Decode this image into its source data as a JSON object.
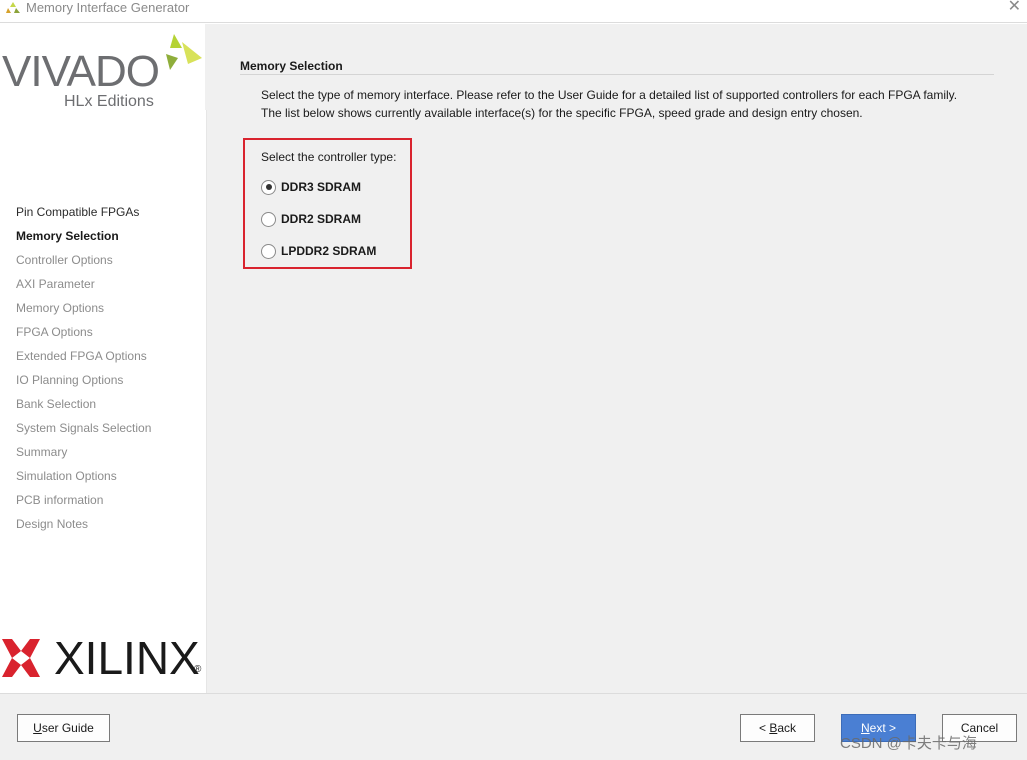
{
  "window": {
    "title": "Memory Interface Generator",
    "close_glyph": "✕"
  },
  "branding": {
    "vivado_word": "VIVADO",
    "hlx_word": "HLx Editions",
    "xilinx_word": "XILINX",
    "xilinx_reg": "®"
  },
  "sidebar": {
    "items": [
      {
        "label": "Pin Compatible FPGAs",
        "state": "done"
      },
      {
        "label": "Memory Selection",
        "state": "active"
      },
      {
        "label": "Controller Options",
        "state": "pending"
      },
      {
        "label": "AXI Parameter",
        "state": "pending"
      },
      {
        "label": "Memory Options",
        "state": "pending"
      },
      {
        "label": "FPGA Options",
        "state": "pending"
      },
      {
        "label": "Extended FPGA Options",
        "state": "pending"
      },
      {
        "label": "IO Planning Options",
        "state": "pending"
      },
      {
        "label": "Bank Selection",
        "state": "pending"
      },
      {
        "label": "System Signals Selection",
        "state": "pending"
      },
      {
        "label": "Summary",
        "state": "pending"
      },
      {
        "label": "Simulation Options",
        "state": "pending"
      },
      {
        "label": "PCB information",
        "state": "pending"
      },
      {
        "label": "Design Notes",
        "state": "pending"
      }
    ]
  },
  "main": {
    "section_title": "Memory Selection",
    "description_line1": "Select the type of memory interface. Please refer to the User Guide for a detailed list of supported controllers for each FPGA family.",
    "description_line2": "The list below shows currently available interface(s) for the specific FPGA, speed grade and design entry chosen.",
    "controller_label": "Select the controller type:",
    "controller_options": [
      {
        "label": "DDR3 SDRAM",
        "checked": true
      },
      {
        "label": "DDR2 SDRAM",
        "checked": false
      },
      {
        "label": "LPDDR2 SDRAM",
        "checked": false
      }
    ],
    "highlight_color": "#d9232e"
  },
  "footer": {
    "user_guide": {
      "mnemonic": "U",
      "rest": "ser Guide"
    },
    "back": {
      "prefix": "< ",
      "mnemonic": "B",
      "rest": "ack"
    },
    "next": {
      "prefix": "",
      "mnemonic": "N",
      "rest": "ext >"
    },
    "cancel": {
      "label": "Cancel"
    }
  },
  "watermark": "CSDN @卡夫卡与海",
  "colors": {
    "accent_primary": "#4a7fd3",
    "vivado_green": "#b5d334",
    "xilinx_red": "#d9232e"
  }
}
